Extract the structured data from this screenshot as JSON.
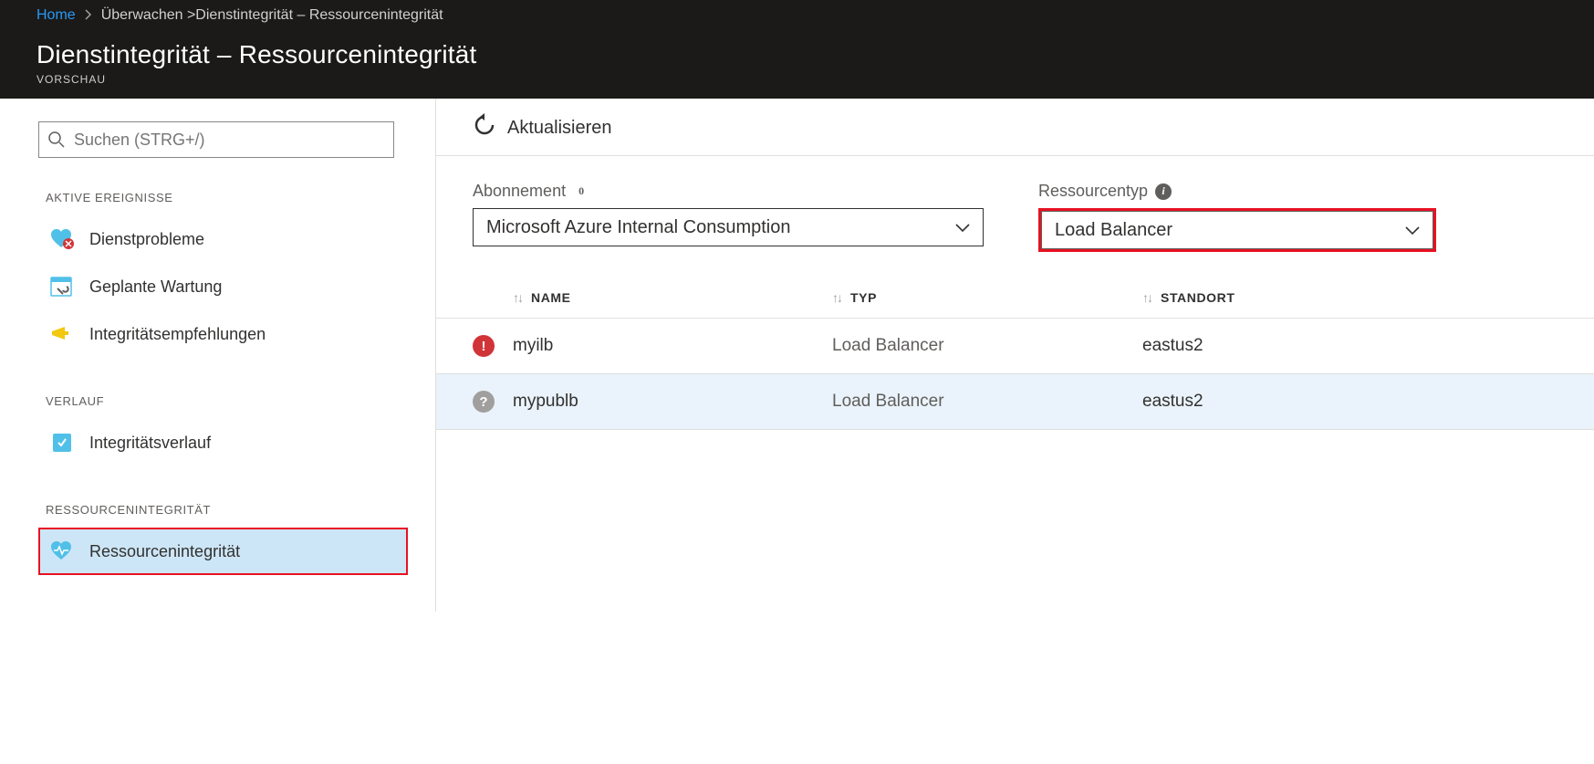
{
  "breadcrumb": {
    "home": "Home",
    "path": "Überwachen >Dienstintegrität –   Ressourcenintegrität"
  },
  "header": {
    "title": "Dienstintegrität –   Ressourcenintegrität",
    "subtitle": "VORSCHAU"
  },
  "search": {
    "placeholder": "Suchen (STRG+/)"
  },
  "sidebar": {
    "section_active": "AKTIVE EREIGNISSE",
    "item_issues": "Dienstprobleme",
    "item_maintenance": "Geplante Wartung",
    "item_recs": "Integritätsempfehlungen",
    "section_history": "VERLAUF",
    "item_history": "Integritätsverlauf",
    "section_resource": "RESSOURCENINTEGRITÄT",
    "item_resource": "Ressourcenintegrität"
  },
  "toolbar": {
    "refresh": "Aktualisieren"
  },
  "filters": {
    "subscription_label": "Abonnement",
    "subscription_info_count": "0",
    "subscription_value": "Microsoft Azure Internal Consumption",
    "type_label": "Ressourcentyp",
    "type_value": "Load Balancer"
  },
  "table": {
    "headers": {
      "name": "NAME",
      "type": "TYP",
      "location": "STANDORT"
    },
    "rows": [
      {
        "status": "error",
        "name": "myilb",
        "type": "Load Balancer",
        "location": "eastus2"
      },
      {
        "status": "unknown",
        "name": "mypublb",
        "type": "Load Balancer",
        "location": "eastus2"
      }
    ]
  }
}
